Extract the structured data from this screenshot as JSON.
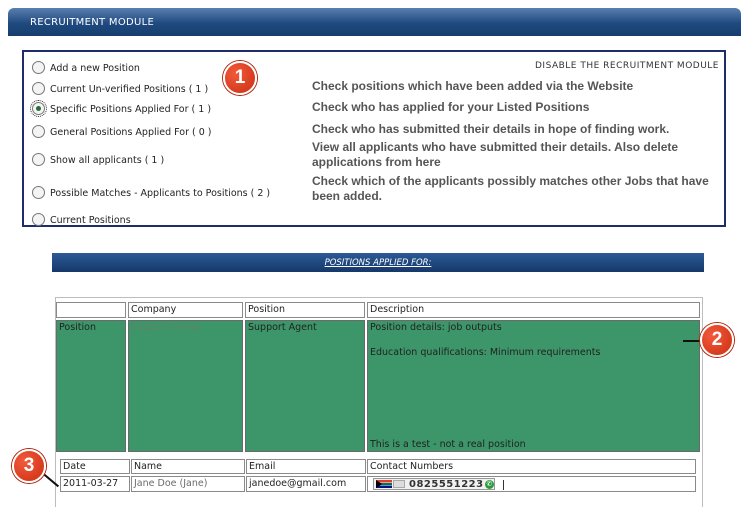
{
  "module_title": "RECRUITMENT MODULE",
  "disable_link": "DISABLE THE RECRUITMENT MODULE",
  "options": [
    {
      "label": "Add a new Position",
      "description": "",
      "checked": false
    },
    {
      "label": "Current Un-verified Positions ( 1 )",
      "description": "Check positions which have been added via the Website",
      "checked": false
    },
    {
      "label": "Specific Positions Applied For ( 1 )",
      "description": "Check who has applied for your Listed Positions",
      "checked": true
    },
    {
      "label": "General Positions Applied For ( 0 )",
      "description": "Check who has submitted their details in hope of finding work.",
      "checked": false
    },
    {
      "label": "Show all applicants ( 1 )",
      "description": "View all applicants who have submitted their details. Also delete applications from here",
      "checked": false
    },
    {
      "label": "Possible Matches - Applicants to Positions ( 2 )",
      "description": "Check which of the applicants possibly matches other Jobs that have been added.",
      "checked": false
    },
    {
      "label": "Current Positions",
      "description": "",
      "checked": false
    }
  ],
  "section_title": "POSITIONS APPLIED FOR:",
  "position_table": {
    "headers": [
      "",
      "Company",
      "Position",
      "Description"
    ],
    "row": {
      "label": "Position",
      "company": "Support Group",
      "position": "Support Agent",
      "description_line1": "Position details: job outputs",
      "description_line2": "Education qualifications: Minimum requirements",
      "description_note": "This is a test - not a real position"
    }
  },
  "applicant_table": {
    "headers": [
      "Date",
      "Name",
      "Email",
      "Contact Numbers"
    ],
    "row": {
      "date": "2011-03-27",
      "name": "Jane Doe (Jane)",
      "email": "janedoe@gmail.com",
      "phone": "0825551223"
    }
  },
  "markers": [
    "1",
    "2",
    "3"
  ],
  "colors": {
    "header_blue": "#1f4a80",
    "panel_border": "#1d2c6b",
    "row_green": "#3c9669",
    "marker_red": "#e0401e"
  },
  "icons": [
    "radio-icon",
    "flag-icon",
    "call-icon"
  ]
}
